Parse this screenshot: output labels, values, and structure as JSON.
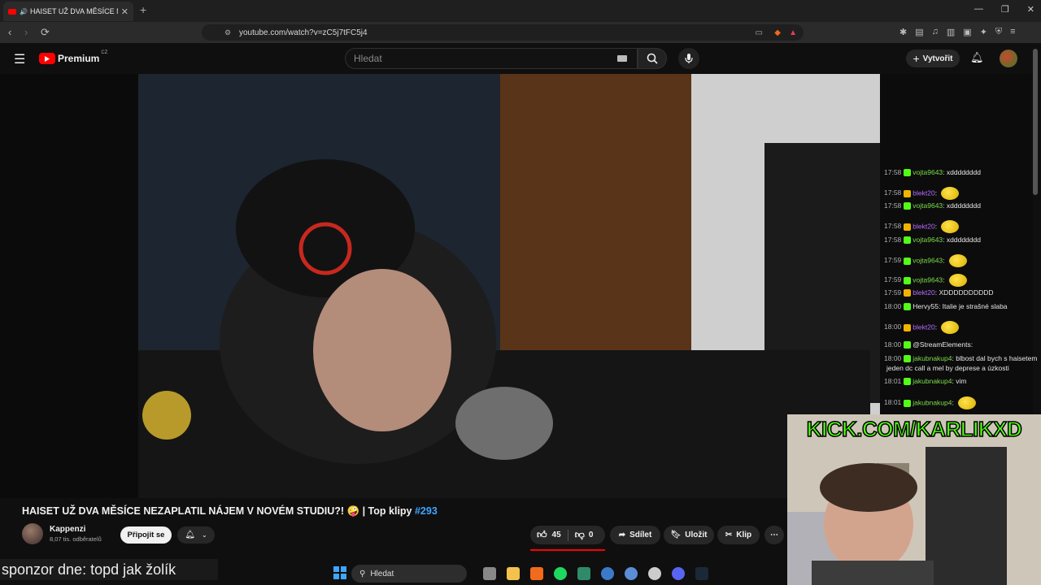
{
  "browser": {
    "tab_title": "HAISET UŽ DVA MĚSÍCE NEZAPLATIL",
    "url": "youtube.com/watch?v=zC5j7tFC5j4"
  },
  "youtube": {
    "logo_text": "Premium",
    "logo_sup": "CZ",
    "search_placeholder": "Hledat",
    "create_label": "Vytvořit"
  },
  "chat": [
    {
      "time": "17:58",
      "user": "vojta9643",
      "color": "green",
      "msg": "xdddddddd"
    },
    {
      "time": "17:58",
      "user": "blekt20",
      "color": "purple",
      "msg": "",
      "emote": true
    },
    {
      "time": "17:58",
      "user": "vojta9643",
      "color": "green",
      "msg": "xdddddddd"
    },
    {
      "time": "17:58",
      "user": "blekt20",
      "color": "purple",
      "msg": "",
      "emote": true
    },
    {
      "time": "17:58",
      "user": "vojta9643",
      "color": "green",
      "msg": "xdddddddd"
    },
    {
      "time": "17:59",
      "user": "vojta9643",
      "color": "green",
      "msg": "",
      "emote": true
    },
    {
      "time": "17:59",
      "user": "vojta9643",
      "color": "green",
      "msg": "",
      "emote": true
    },
    {
      "time": "17:59",
      "user": "blekt20",
      "color": "purple",
      "msg": "XDDDDDDDDDD"
    },
    {
      "time": "18:00",
      "user": "Hervy55",
      "color": "white",
      "msg": "Italie je strašné slaba"
    },
    {
      "time": "18:00",
      "user": "blekt20",
      "color": "purple",
      "msg": "",
      "emote": true
    },
    {
      "time": "18:00",
      "user": "@StreamElements",
      "color": "white",
      "msg": ""
    },
    {
      "time": "18:00",
      "user": "jakubnakup4",
      "color": "green",
      "msg": "blbost dal bych s haisetem"
    },
    {
      "time": "",
      "user": "",
      "color": "white",
      "msg": "jeden dc call a mel by deprese a úzkosti"
    },
    {
      "time": "18:01",
      "user": "jakubnakup4",
      "color": "green",
      "msg": "vim"
    },
    {
      "time": "18:01",
      "user": "jakubnakup4",
      "color": "green",
      "msg": "",
      "emote": true
    }
  ],
  "overlay": {
    "kick_banner": "KICK.COM/KARLIKXD",
    "sponsor": "sponzor dne: topd jak žolík"
  },
  "video": {
    "title_main": "HAISET UŽ DVA MĚSÍCE NEZAPLATIL NÁJEM V NOVÉM STUDIU?! 🤪 | Top klipy",
    "title_hash": "#293",
    "channel_name": "Kappenzi",
    "subscribers": "8,07 tis. odběratelů",
    "join_label": "Připojit se",
    "likes": "45",
    "dislikes": "0",
    "share_label": "Sdílet",
    "save_label": "Uložit",
    "clip_label": "Klip"
  },
  "taskbar": {
    "search_label": "Hledat"
  }
}
